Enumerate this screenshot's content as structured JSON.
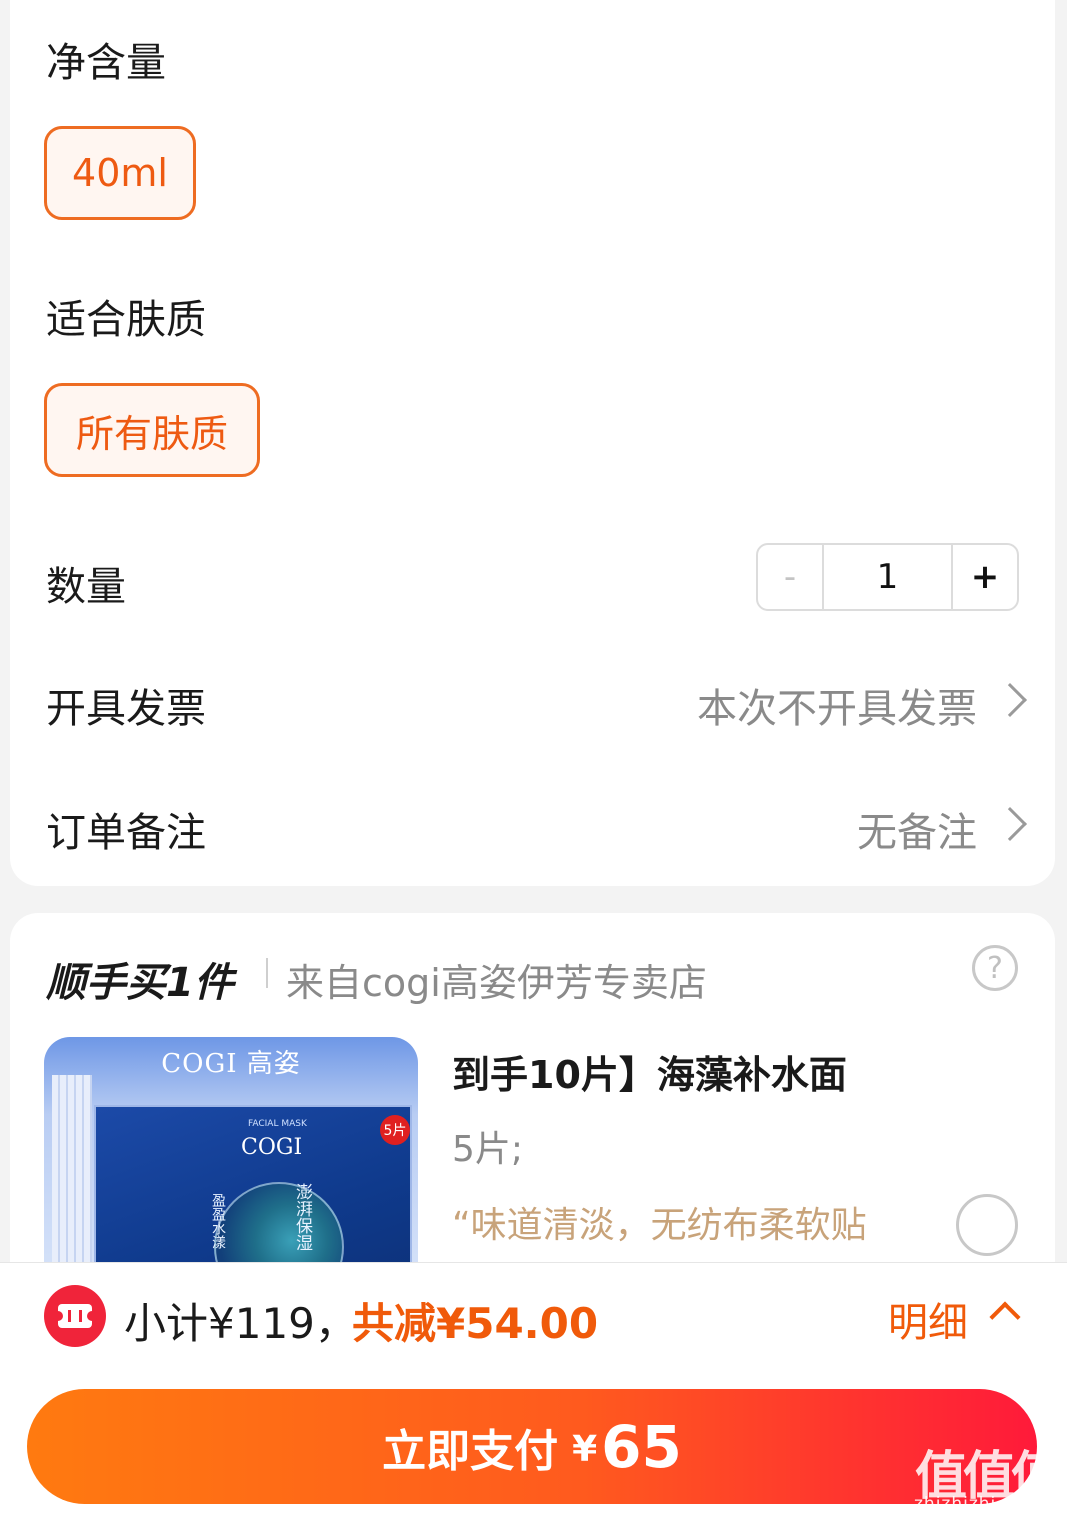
{
  "spec": {
    "net_content_title": "净含量",
    "net_content_option": "40ml",
    "skin_type_title": "适合肤质",
    "skin_type_option": "所有肤质",
    "quantity_title": "数量",
    "quantity_minus": "-",
    "quantity_value": "1",
    "quantity_plus": "+",
    "invoice_title": "开具发票",
    "invoice_value": "本次不开具发票",
    "remark_title": "订单备注",
    "remark_value": "无备注"
  },
  "addon": {
    "title": "顺手买1件",
    "store": "来自cogi高姿伊芳专卖店",
    "help": "?",
    "product": {
      "image_brand": "COGI 高姿",
      "image_logo": "COGI",
      "image_sub": "FACIAL MASK",
      "image_badge": "5片",
      "image_cn1": "盈盈水漾",
      "image_cn2": "澎湃保湿",
      "name": "到手10片】海藻补水面",
      "spec": "5片;",
      "review": "“味道清淡，无纺布柔软贴"
    }
  },
  "footer": {
    "subtotal": "小计¥119，",
    "saved": "共减¥54.00",
    "detail": "明细",
    "pay_label": "立即支付",
    "pay_currency": "¥",
    "pay_amount": "65"
  },
  "watermark": {
    "logo": "值值值",
    "site": "zhizhizhi.com"
  },
  "colors": {
    "accent": "#f05a0a",
    "pay_gradient_start": "#ff7a10",
    "pay_gradient_end": "#ff1a3a",
    "coupon_red": "#f0243a",
    "review_gold": "#c8a37a"
  },
  "icons": [
    "chevron-right-icon",
    "help-icon",
    "coupon-icon",
    "chevron-up-icon"
  ]
}
